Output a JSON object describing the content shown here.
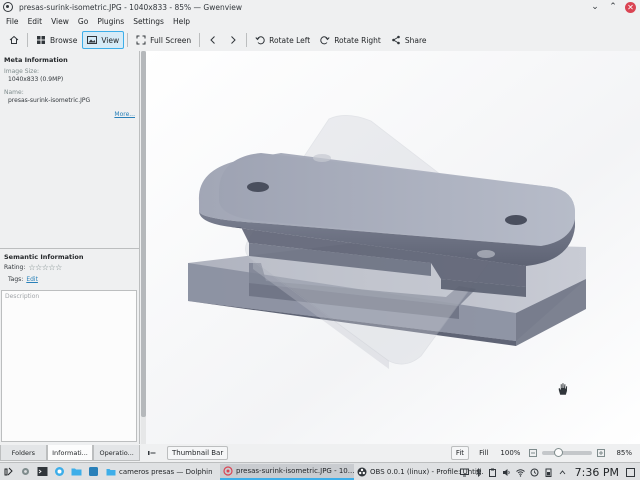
{
  "window": {
    "title": "presas-surink-isometric.JPG - 1040x833 - 85% — Gwenview",
    "app_icon": "gwenview-icon",
    "buttons": [
      "chevron-down-icon",
      "chevron-up-icon",
      "close-icon"
    ]
  },
  "menu": [
    "File",
    "Edit",
    "View",
    "Go",
    "Plugins",
    "Settings",
    "Help"
  ],
  "toolbar": {
    "browse": "Browse",
    "view": "View",
    "full_screen": "Full Screen",
    "rotate_left": "Rotate Left",
    "rotate_right": "Rotate Right",
    "share": "Share"
  },
  "sidebar": {
    "meta_title": "Meta Information",
    "image_size_label": "Image Size:",
    "image_size_value": "1040x833 (0.9MP)",
    "name_label": "Name:",
    "name_value": "presas-surink-isometric.JPG",
    "more_link": "More...",
    "semantic_title": "Semantic Information",
    "rating_label": "Rating:",
    "rating_stars": "☆☆☆☆☆",
    "rating_value": 0,
    "tags_label": "Tags:",
    "edit_link": "Edit",
    "description_placeholder": "Description",
    "tabs": [
      "Folders",
      "Informati...",
      "Operatio..."
    ]
  },
  "statusbar": {
    "thumbnail_bar": "Thumbnail Bar",
    "fit": "Fit",
    "fill": "Fill",
    "zoom_100": "100%",
    "zoom_value": "85%"
  },
  "taskbar": {
    "items": [
      {
        "icon": "folder-icon",
        "label": "cameros presas — Dolphin"
      },
      {
        "icon": "gwenview-icon",
        "label": "presas-surink-isometric.JPG - 10..."
      },
      {
        "icon": "obs-icon",
        "label": "OBS 0.0.1 (linux) - Profile: Untitl..."
      }
    ],
    "clock": "7:36 PM"
  },
  "colors": {
    "accent": "#3daee9",
    "background": "#eff0f1",
    "link": "#2980b9"
  }
}
